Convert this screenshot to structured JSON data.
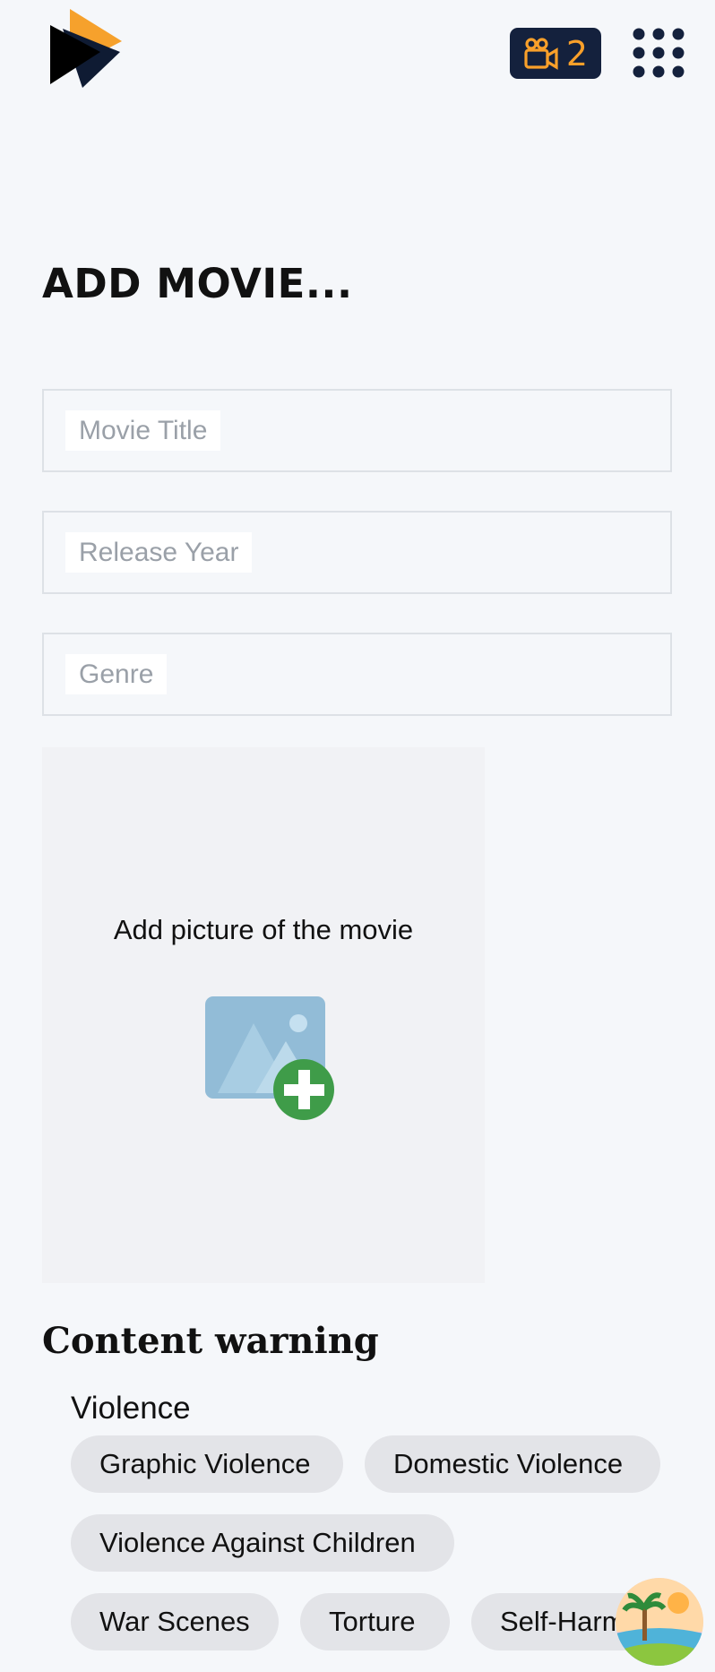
{
  "header": {
    "logo_icon": "play-logo-icon",
    "badge_icon": "movie-camera-icon",
    "badge_count": "2",
    "menu_icon": "grid-menu-icon",
    "badge_bg": "#14213d",
    "badge_fg": "#f9a02a"
  },
  "page": {
    "title": "ADD MOVIE..."
  },
  "form": {
    "title_placeholder": "Movie Title",
    "year_placeholder": "Release Year",
    "genre_placeholder": "Genre"
  },
  "picture": {
    "label": "Add picture of the movie",
    "icon": "add-image-icon"
  },
  "content_warning": {
    "title": "Content warning",
    "groups": [
      {
        "name": "Violence",
        "chips": [
          "Graphic Violence",
          "Domestic Violence",
          "Violence Against Children",
          "War Scenes",
          "Torture",
          "Self-Harm"
        ]
      }
    ]
  },
  "floating": {
    "icon": "beach-avatar-icon"
  }
}
